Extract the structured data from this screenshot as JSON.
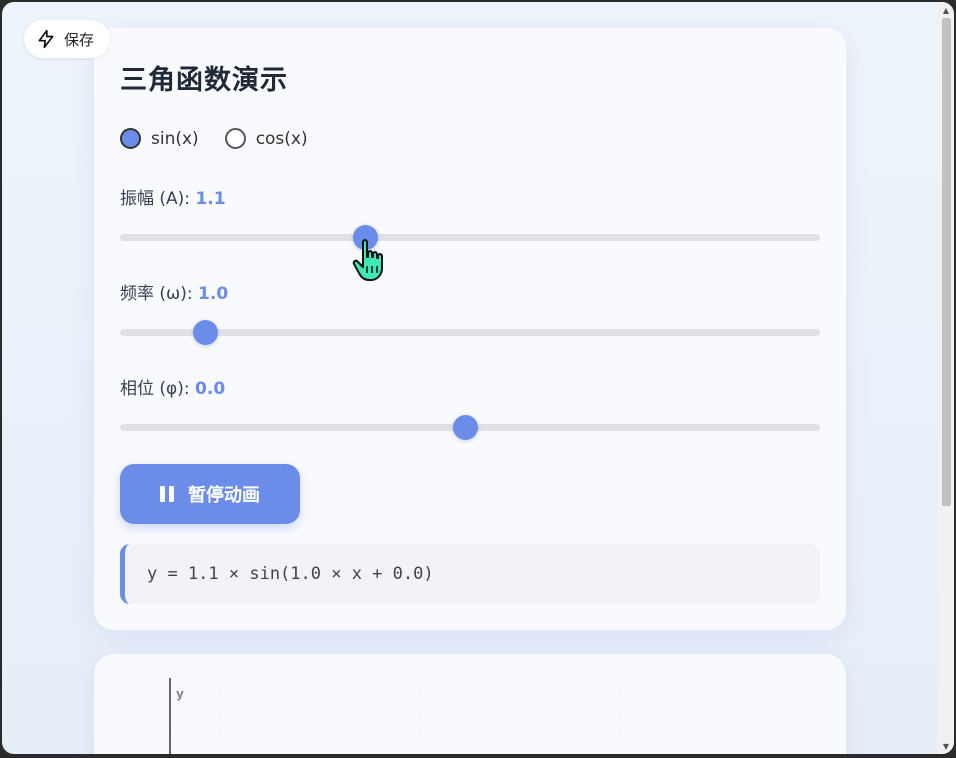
{
  "save": {
    "label": "保存",
    "icon": "lightning-icon"
  },
  "title": "三角函数演示",
  "functions": [
    {
      "label": "sin(x)",
      "checked": true
    },
    {
      "label": "cos(x)",
      "checked": false
    }
  ],
  "controls": {
    "amplitude": {
      "label": "振幅 (A):",
      "value": "1.1",
      "fraction": 0.35
    },
    "frequency": {
      "label": "频率 (ω):",
      "value": "1.0",
      "fraction": 0.122
    },
    "phase": {
      "label": "相位 (φ):",
      "value": "0.0",
      "fraction": 0.493
    }
  },
  "pause_button": {
    "label": "暂停动画",
    "icon": "pause-icon"
  },
  "formula": "y = 1.1 × sin(1.0 × x + 0.0)",
  "chart": {
    "y_axis_label": "y"
  },
  "colors": {
    "accent": "#6b8ce8",
    "text": "#1f2937",
    "track": "#dfe1e6"
  }
}
